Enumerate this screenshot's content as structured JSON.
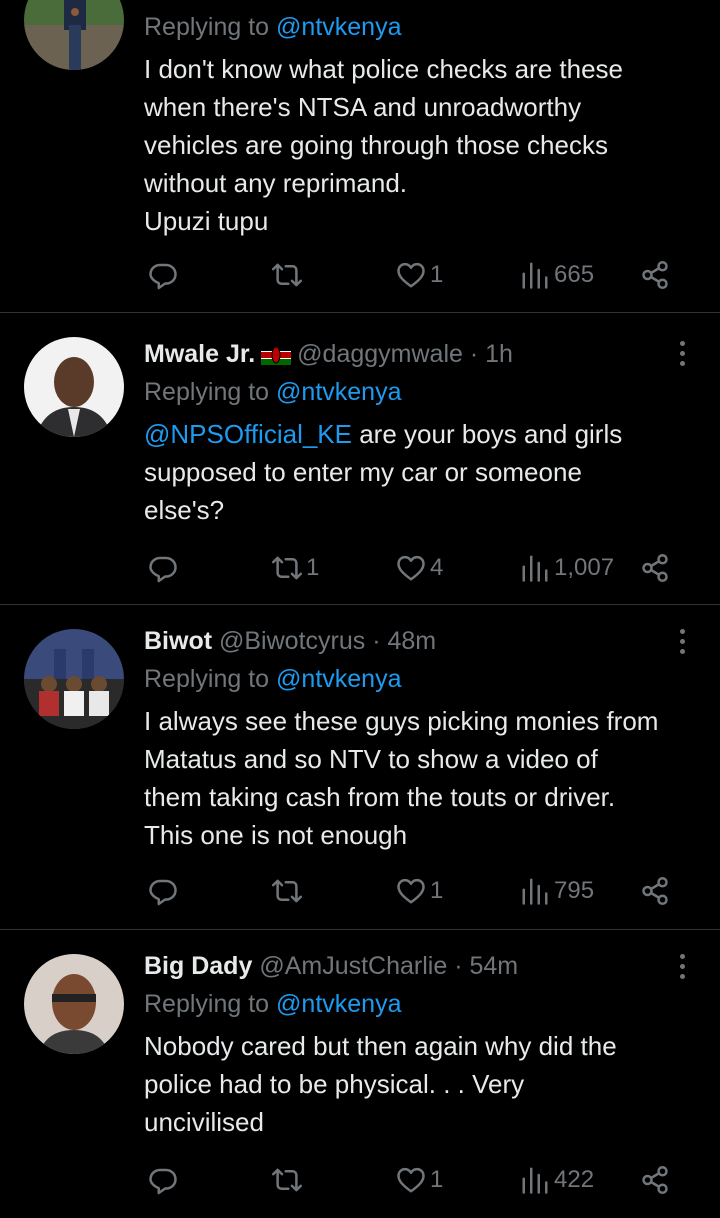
{
  "tweets": [
    {
      "name": "",
      "handle": "",
      "time": "",
      "replying_prefix": "Replying to",
      "replying_to": "@ntvkenya",
      "body_lines": [
        "I don't know what police checks are these",
        "when there's NTSA and unroadworthy",
        "vehicles are going through those checks",
        "without any reprimand.",
        "Upuzi tupu"
      ],
      "replies": "",
      "retweets": "",
      "likes": "1",
      "views": "665"
    },
    {
      "name": "Mwale Jr.",
      "handle": "@daggymwale",
      "time": "· 1h",
      "replying_prefix": "Replying to",
      "replying_to": "@ntvkenya",
      "body_mention": "@NPSOfficial_KE",
      "body_first_rest": " are your boys and girls",
      "body_lines": [
        "supposed to enter my car or someone",
        "else's?"
      ],
      "replies": "",
      "retweets": "1",
      "likes": "4",
      "views": "1,007"
    },
    {
      "name": "Biwot",
      "handle": "@Biwotcyrus",
      "time": "· 48m",
      "replying_prefix": "Replying to",
      "replying_to": "@ntvkenya",
      "body_lines": [
        "I always see these guys picking monies from",
        "Matatus and so NTV to show a video of",
        "them taking cash from the touts or driver.",
        "This one is not enough"
      ],
      "replies": "",
      "retweets": "",
      "likes": "1",
      "views": "795"
    },
    {
      "name": "Big Dady",
      "handle": "@AmJustCharlie",
      "time": "· 54m",
      "replying_prefix": "Replying to",
      "replying_to": "@ntvkenya",
      "body_lines": [
        "Nobody cared but then again why did the",
        "police had to be physical. . . Very",
        "uncivilised"
      ],
      "replies": "",
      "retweets": "",
      "likes": "1",
      "views": "422"
    }
  ],
  "icons": {
    "reply": "reply-icon",
    "retweet": "retweet-icon",
    "like": "heart-icon",
    "views": "views-icon",
    "share": "share-icon",
    "more": "more-icon",
    "flag": "kenya-flag-icon"
  },
  "colors": {
    "background": "#000000",
    "text": "#e7e9ea",
    "muted": "#71767b",
    "link": "#1d9bf0",
    "divider": "#2f3336"
  }
}
